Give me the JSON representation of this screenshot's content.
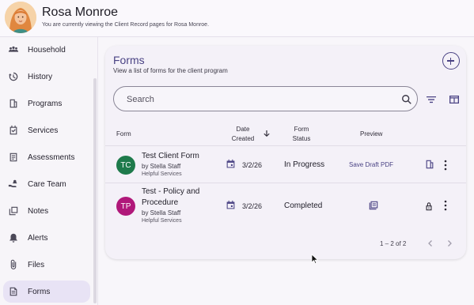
{
  "header": {
    "client_name": "Rosa Monroe",
    "subtitle": "You are currently viewing the Client Record pages for Rosa Monroe."
  },
  "sidebar": {
    "items": [
      {
        "label": "Household",
        "icon": "household-icon",
        "active": false
      },
      {
        "label": "History",
        "icon": "history-icon",
        "active": false
      },
      {
        "label": "Programs",
        "icon": "programs-icon",
        "active": false
      },
      {
        "label": "Services",
        "icon": "services-icon",
        "active": false
      },
      {
        "label": "Assessments",
        "icon": "assessments-icon",
        "active": false
      },
      {
        "label": "Care Team",
        "icon": "care-team-icon",
        "active": false
      },
      {
        "label": "Notes",
        "icon": "notes-icon",
        "active": false
      },
      {
        "label": "Alerts",
        "icon": "bell-icon",
        "active": false
      },
      {
        "label": "Files",
        "icon": "paperclip-icon",
        "active": false
      },
      {
        "label": "Forms",
        "icon": "forms-icon",
        "active": true
      }
    ]
  },
  "forms": {
    "title": "Forms",
    "description": "View a list of forms for the client program",
    "search_placeholder": "Search",
    "columns": {
      "form": "Form",
      "date_created_1": "Date",
      "date_created_2": "Created",
      "form_status_1": "Form",
      "form_status_2": "Status",
      "preview": "Preview"
    },
    "rows": [
      {
        "initials": "TC",
        "avatar_color": "#1e7a4b",
        "name_line1": "Test Client Form",
        "name_line2": "",
        "by": "by Stella Staff",
        "org": "Helpful Services",
        "date": "3/2/26",
        "status": "In Progress",
        "preview": "Save Draft PDF"
      },
      {
        "initials": "TP",
        "avatar_color": "#b0187a",
        "name_line1": "Test - Policy and",
        "name_line2": "Procedure",
        "by": "by Stella Staff",
        "org": "Helpful Services",
        "date": "3/2/26",
        "status": "Completed",
        "preview": ""
      }
    ],
    "pagination": "1 – 2 of 2"
  },
  "colors": {
    "accent": "#4a4384",
    "active_nav": "#e8e3f5"
  }
}
